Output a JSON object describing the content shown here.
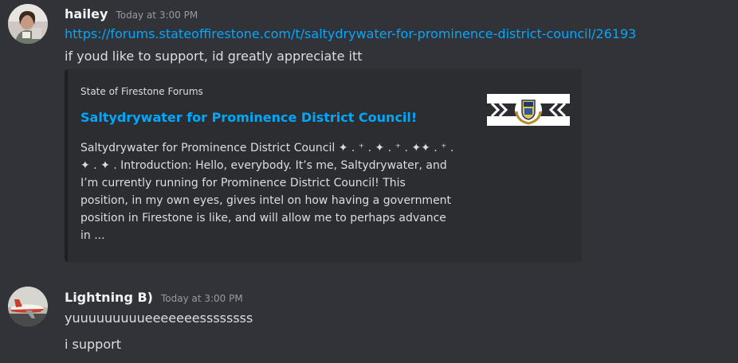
{
  "messages": [
    {
      "username": "hailey",
      "timestamp": "Today at 3:00 PM",
      "link": "https://forums.stateoffirestone.com/t/saltydrywater-for-prominence-district-council/26193",
      "text": "if youd like to support, id greatly appreciate itt",
      "embed": {
        "provider": "State of Firestone Forums",
        "title": "Saltydrywater for Prominence District Council!",
        "description_lines": [
          "Saltydrywater for Prominence District Council ✦ . ⁺ . ✦ . ⁺ . ✦✦ . ⁺ .",
          "✦ . ✦ . Introduction: Hello, everybody. It’s me, Saltydrywater, and",
          "I’m currently running for Prominence District Council! This",
          "position, in my own eyes, gives intel on how having a government",
          "position in Firestone is like, and will allow me to perhaps advance",
          "in ..."
        ],
        "thumbnail_icon": "firestone-seal-icon"
      }
    },
    {
      "username": "Lightning B)",
      "timestamp": "Today at 3:00 PM",
      "lines": [
        "yuuuuuuuuueeeeeeessssssss",
        "i support"
      ]
    }
  ],
  "colors": {
    "background": "#313338",
    "embed_bg": "#2b2d31",
    "link": "#00a8fc",
    "username": "#f2f3f5",
    "timestamp": "#949ba4"
  }
}
